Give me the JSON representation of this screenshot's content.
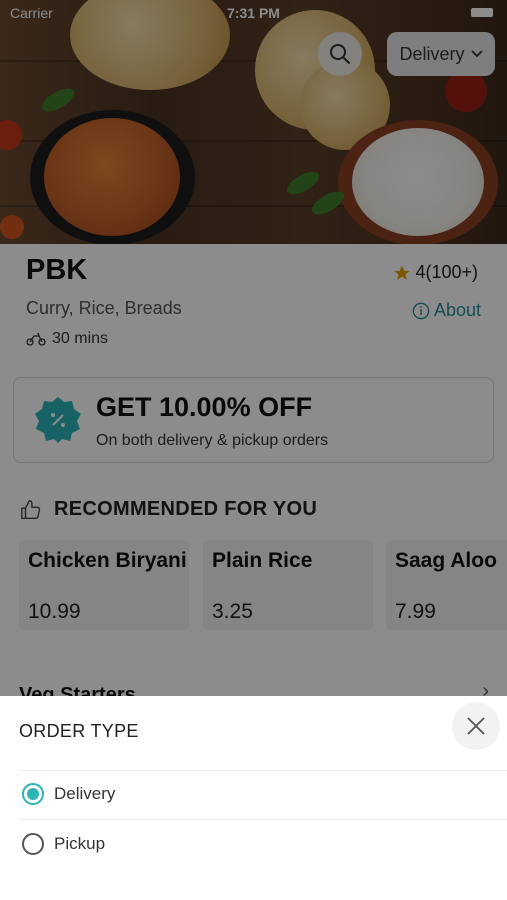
{
  "status_bar": {
    "carrier": "Carrier",
    "time": "7:31 PM"
  },
  "header": {
    "delivery_label": "Delivery"
  },
  "restaurant": {
    "name": "PBK",
    "rating": "4(100+)",
    "cuisine": "Curry, Rice, Breads",
    "about": "About",
    "delivery_time": "30 mins"
  },
  "offer": {
    "title": "GET 10.00% OFF",
    "subtitle": "On both delivery & pickup orders"
  },
  "recommended": {
    "title": "RECOMMENDED FOR YOU",
    "items": [
      {
        "name": "Chicken Biryani",
        "price": "10.99"
      },
      {
        "name": "Plain Rice",
        "price": "3.25"
      },
      {
        "name": "Saag Aloo",
        "price": "7.99"
      }
    ]
  },
  "menu_section": {
    "label": "Veg Starters"
  },
  "order_sheet": {
    "title": "ORDER TYPE",
    "options": [
      {
        "label": "Delivery",
        "selected": true
      },
      {
        "label": "Pickup",
        "selected": false
      }
    ]
  },
  "colors": {
    "accent": "#2bb3b8",
    "about_link": "#2b8a9a",
    "star": "#e0a100"
  }
}
